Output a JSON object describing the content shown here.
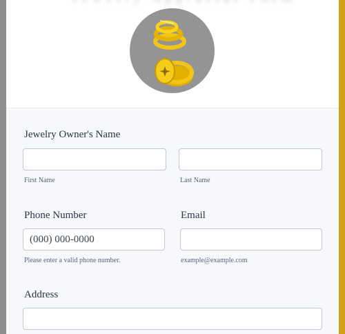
{
  "form": {
    "blurred_heading": "Jewelry Appraisal Form"
  },
  "fields": {
    "owner_name": {
      "label": "Jewelry Owner's Name",
      "first_sublabel": "First Name",
      "last_sublabel": "Last Name",
      "first_value": "",
      "last_value": ""
    },
    "phone": {
      "label": "Phone Number",
      "placeholder": "(000) 000-0000",
      "sublabel": "Please enter a valid phone number."
    },
    "email": {
      "label": "Email",
      "placeholder": "",
      "sublabel": "example@example.com"
    },
    "address": {
      "label": "Address",
      "value": ""
    }
  },
  "colors": {
    "left_edge": "#8e8e8e",
    "right_edge": "#d4a017",
    "logo_circle": "#949494",
    "gold": "#f2c417"
  },
  "icons": [
    "rings-logo-icon"
  ]
}
